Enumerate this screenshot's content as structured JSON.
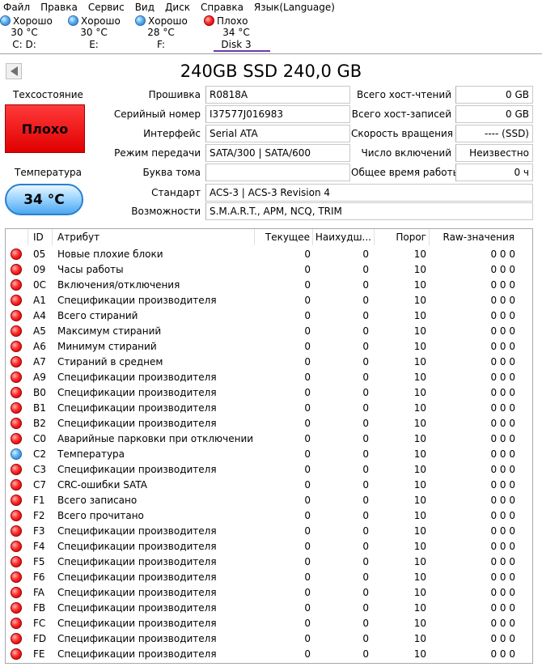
{
  "menu": [
    "Файл",
    "Правка",
    "Сервис",
    "Вид",
    "Диск",
    "Справка",
    "Язык(Language)"
  ],
  "disks": [
    {
      "status": "Хорошо",
      "temp": "30 °C",
      "label": "C: D:",
      "color": "blue"
    },
    {
      "status": "Хорошо",
      "temp": "30 °C",
      "label": "E:",
      "color": "blue"
    },
    {
      "status": "Хорошо",
      "temp": "28 °C",
      "label": "F:",
      "color": "blue"
    },
    {
      "status": "Плохо",
      "temp": "34 °C",
      "label": "Disk 3",
      "color": "red"
    }
  ],
  "title": "240GB SSD 240,0 GB",
  "health": {
    "label": "Техсостояние",
    "value": "Плохо"
  },
  "temperature": {
    "label": "Температура",
    "value": "34 °C"
  },
  "info": {
    "firmware": {
      "label": "Прошивка",
      "value": "R0818A"
    },
    "serial": {
      "label": "Серийный номер",
      "value": "I37577J016983"
    },
    "interface": {
      "label": "Интерфейс",
      "value": "Serial ATA"
    },
    "transfer": {
      "label": "Режим передачи",
      "value": "SATA/300 | SATA/600"
    },
    "volume": {
      "label": "Буква тома",
      "value": ""
    },
    "standard": {
      "label": "Стандарт",
      "value": "ACS-3 | ACS-3 Revision 4"
    },
    "features": {
      "label": "Возможности",
      "value": "S.M.A.R.T., APM, NCQ, TRIM"
    },
    "host_reads": {
      "label": "Всего хост-чтений",
      "value": "0 GB"
    },
    "host_writes": {
      "label": "Всего хост-записей",
      "value": "0 GB"
    },
    "rotation": {
      "label": "Скорость вращения",
      "value": "---- (SSD)"
    },
    "power_count": {
      "label": "Число включений",
      "value": "Неизвестно"
    },
    "power_hours": {
      "label": "Общее время работы",
      "value": "0 ч"
    }
  },
  "table": {
    "headers": {
      "id": "ID",
      "attr": "Атрибут",
      "current": "Текущее",
      "worst": "Наихудш...",
      "threshold": "Порог",
      "raw": "Raw-значения"
    },
    "rows": [
      {
        "status": "red",
        "id": "05",
        "name": "Новые плохие блоки",
        "current": "0",
        "worst": "0",
        "threshold": "10",
        "raw": "0 0 0"
      },
      {
        "status": "red",
        "id": "09",
        "name": "Часы работы",
        "current": "0",
        "worst": "0",
        "threshold": "10",
        "raw": "0 0 0"
      },
      {
        "status": "red",
        "id": "0C",
        "name": "Включения/отключения",
        "current": "0",
        "worst": "0",
        "threshold": "10",
        "raw": "0 0 0"
      },
      {
        "status": "red",
        "id": "A1",
        "name": "Спецификации производителя",
        "current": "0",
        "worst": "0",
        "threshold": "10",
        "raw": "0 0 0"
      },
      {
        "status": "red",
        "id": "A4",
        "name": "Всего стираний",
        "current": "0",
        "worst": "0",
        "threshold": "10",
        "raw": "0 0 0"
      },
      {
        "status": "red",
        "id": "A5",
        "name": "Максимум стираний",
        "current": "0",
        "worst": "0",
        "threshold": "10",
        "raw": "0 0 0"
      },
      {
        "status": "red",
        "id": "A6",
        "name": "Минимум стираний",
        "current": "0",
        "worst": "0",
        "threshold": "10",
        "raw": "0 0 0"
      },
      {
        "status": "red",
        "id": "A7",
        "name": "Стираний в среднем",
        "current": "0",
        "worst": "0",
        "threshold": "10",
        "raw": "0 0 0"
      },
      {
        "status": "red",
        "id": "A9",
        "name": "Спецификации производителя",
        "current": "0",
        "worst": "0",
        "threshold": "10",
        "raw": "0 0 0"
      },
      {
        "status": "red",
        "id": "B0",
        "name": "Спецификации производителя",
        "current": "0",
        "worst": "0",
        "threshold": "10",
        "raw": "0 0 0"
      },
      {
        "status": "red",
        "id": "B1",
        "name": "Спецификации производителя",
        "current": "0",
        "worst": "0",
        "threshold": "10",
        "raw": "0 0 0"
      },
      {
        "status": "red",
        "id": "B2",
        "name": "Спецификации производителя",
        "current": "0",
        "worst": "0",
        "threshold": "10",
        "raw": "0 0 0"
      },
      {
        "status": "red",
        "id": "C0",
        "name": "Аварийные парковки при отключении пи...",
        "current": "0",
        "worst": "0",
        "threshold": "10",
        "raw": "0 0 0"
      },
      {
        "status": "blue",
        "id": "C2",
        "name": "Температура",
        "current": "0",
        "worst": "0",
        "threshold": "10",
        "raw": "0 0 0"
      },
      {
        "status": "red",
        "id": "C3",
        "name": "Спецификации производителя",
        "current": "0",
        "worst": "0",
        "threshold": "10",
        "raw": "0 0 0"
      },
      {
        "status": "red",
        "id": "C7",
        "name": "CRC-ошибки SATA",
        "current": "0",
        "worst": "0",
        "threshold": "10",
        "raw": "0 0 0"
      },
      {
        "status": "red",
        "id": "F1",
        "name": "Всего записано",
        "current": "0",
        "worst": "0",
        "threshold": "10",
        "raw": "0 0 0"
      },
      {
        "status": "red",
        "id": "F2",
        "name": "Всего прочитано",
        "current": "0",
        "worst": "0",
        "threshold": "10",
        "raw": "0 0 0"
      },
      {
        "status": "red",
        "id": "F3",
        "name": "Спецификации производителя",
        "current": "0",
        "worst": "0",
        "threshold": "10",
        "raw": "0 0 0"
      },
      {
        "status": "red",
        "id": "F4",
        "name": "Спецификации производителя",
        "current": "0",
        "worst": "0",
        "threshold": "10",
        "raw": "0 0 0"
      },
      {
        "status": "red",
        "id": "F5",
        "name": "Спецификации производителя",
        "current": "0",
        "worst": "0",
        "threshold": "10",
        "raw": "0 0 0"
      },
      {
        "status": "red",
        "id": "F6",
        "name": "Спецификации производителя",
        "current": "0",
        "worst": "0",
        "threshold": "10",
        "raw": "0 0 0"
      },
      {
        "status": "red",
        "id": "FA",
        "name": "Спецификации производителя",
        "current": "0",
        "worst": "0",
        "threshold": "10",
        "raw": "0 0 0"
      },
      {
        "status": "red",
        "id": "FB",
        "name": "Спецификации производителя",
        "current": "0",
        "worst": "0",
        "threshold": "10",
        "raw": "0 0 0"
      },
      {
        "status": "red",
        "id": "FC",
        "name": "Спецификации производителя",
        "current": "0",
        "worst": "0",
        "threshold": "10",
        "raw": "0 0 0"
      },
      {
        "status": "red",
        "id": "FD",
        "name": "Спецификации производителя",
        "current": "0",
        "worst": "0",
        "threshold": "10",
        "raw": "0 0 0"
      },
      {
        "status": "red",
        "id": "FE",
        "name": "Спецификации производителя",
        "current": "0",
        "worst": "0",
        "threshold": "10",
        "raw": "0 0 0"
      }
    ]
  }
}
